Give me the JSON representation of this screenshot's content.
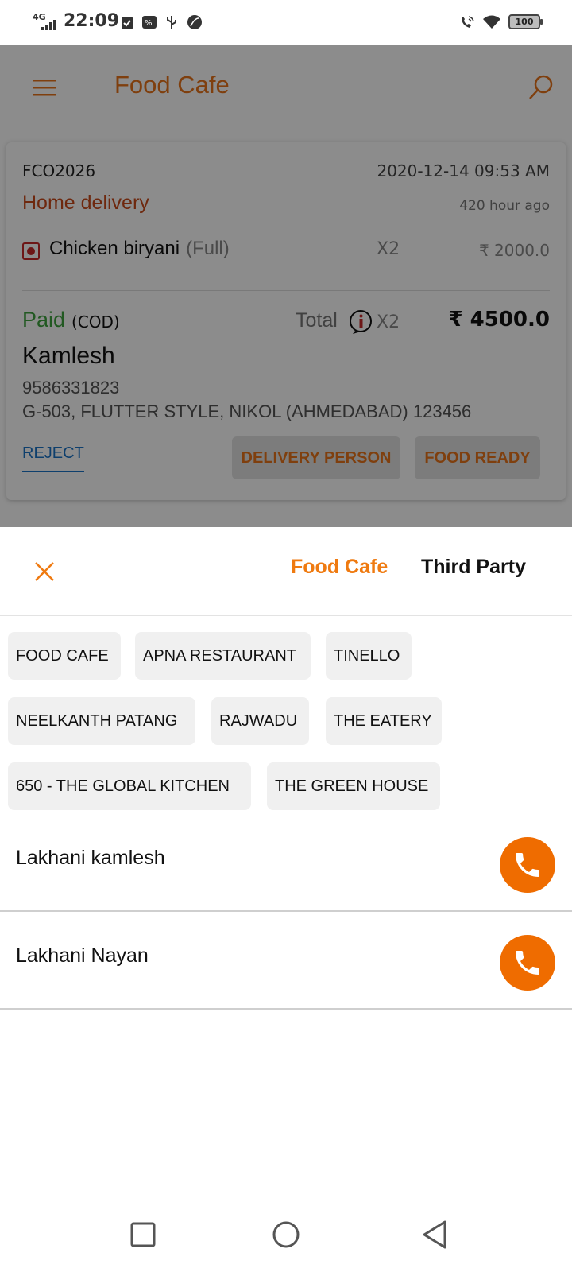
{
  "status_bar": {
    "network": "4G",
    "time": "22:09",
    "battery": "100"
  },
  "appbar": {
    "title": "Food Cafe"
  },
  "order": {
    "id": "FCO2026",
    "datetime": "2020-12-14 09:53 AM",
    "type": "Home delivery",
    "time_ago": "420 hour ago",
    "item": {
      "name": "Chicken biryani",
      "portion": "(Full)",
      "qty": "X2",
      "price": "₹ 2000.0"
    },
    "payment_status": "Paid",
    "payment_mode": "(COD)",
    "total_label": "Total",
    "total_qty": "X2",
    "total_amount": "₹ 4500.0",
    "customer_name": "Kamlesh",
    "customer_phone": "9586331823",
    "customer_address": "G-503, FLUTTER STYLE, NIKOL (AHMEDABAD) 123456",
    "actions": {
      "reject": "REJECT",
      "delivery_person": "DELIVERY PERSON",
      "food_ready": "FOOD READY"
    }
  },
  "sheet": {
    "tabs": [
      "Food Cafe",
      "Third Party"
    ],
    "active_tab": "Food Cafe",
    "chips": [
      "FOOD CAFE",
      "APNA RESTAURANT",
      "TINELLO",
      "NEELKANTH PATANG",
      "RAJWADU",
      "THE EATERY",
      "650 - THE GLOBAL KITCHEN",
      "THE GREEN HOUSE"
    ],
    "delivery_persons": [
      {
        "name": "Lakhani kamlesh"
      },
      {
        "name": "Lakhani Nayan"
      }
    ]
  },
  "colors": {
    "accent": "#ef7a10",
    "paid": "#3fa33f",
    "reject": "#1a73c7",
    "call": "#ef6c00"
  },
  "icons": [
    "menu-icon",
    "search-icon",
    "info-icon",
    "close-icon",
    "phone-icon",
    "nav-recents-icon",
    "nav-home-icon",
    "nav-back-icon"
  ]
}
